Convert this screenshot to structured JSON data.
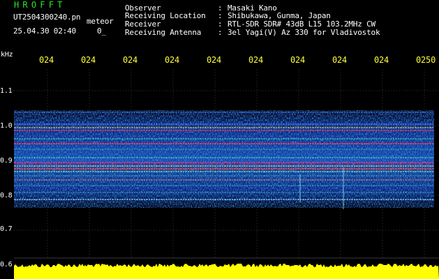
{
  "header": {
    "logo": "HROFFT",
    "filename": "UT2504300240.pn",
    "meteor_label": "meteor",
    "datetime": "25.04.30 02:40",
    "count": "0_",
    "info": [
      {
        "label": "Observer",
        "value": "Masaki Kano"
      },
      {
        "label": "Receiving Location",
        "value": "Shibukawa, Gunma, Japan"
      },
      {
        "label": "Receiver",
        "value": "RTL-SDR SDR# 43dB L15 103.2MHz CW"
      },
      {
        "label": "Receiving Antenna",
        "value": "3el Yagi(V) Az 330 for Vladivostok"
      }
    ],
    "separator": ":"
  },
  "axes": {
    "y_unit": "kHz",
    "x_ticks": [
      "024",
      "024",
      "024",
      "024",
      "024",
      "024",
      "024",
      "024",
      "024",
      "0250"
    ],
    "y_ticks": [
      "1.1",
      "1.0",
      "0.9",
      "0.8",
      "0.7",
      "0.6"
    ]
  },
  "colors": {
    "background": "#000000",
    "logo": "#22ee22",
    "tick_labels": "#ffff33",
    "noise_bar": "#ffff00",
    "grid": "#2a2a2a"
  }
}
